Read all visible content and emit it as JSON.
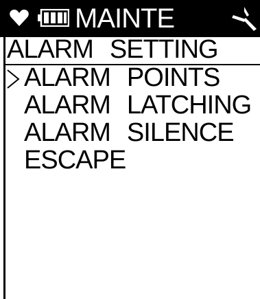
{
  "status_bar": {
    "title": "MAINTE",
    "heart_icon": "heart-icon",
    "battery_icon": "battery-icon",
    "signal_icon": "signal-icon"
  },
  "header": {
    "word1": "ALARM",
    "word2": "SETTING"
  },
  "menu": {
    "cursor_glyph": ">",
    "selected_index": 0,
    "items": [
      {
        "word1": "ALARM",
        "word2": "POINTS"
      },
      {
        "word1": "ALARM",
        "word2": "LATCHING"
      },
      {
        "word1": "ALARM",
        "word2": "SILENCE"
      },
      {
        "word1": "ESCAPE",
        "word2": ""
      }
    ]
  },
  "colors": {
    "background": "#ffffff",
    "foreground": "#000000",
    "titlebar_bg": "#000000",
    "titlebar_fg": "#ffffff"
  }
}
